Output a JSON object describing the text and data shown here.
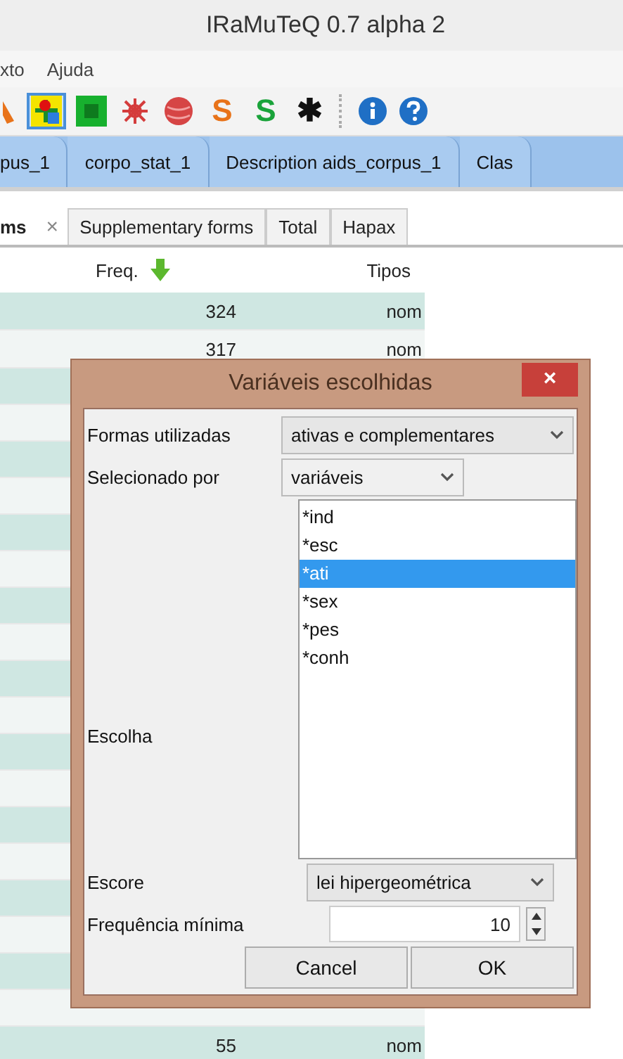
{
  "window": {
    "title": "IRaMuTeQ 0.7 alpha 2"
  },
  "menu": [
    "xto",
    "Ajuda"
  ],
  "toolbar": [
    {
      "kind": "partial",
      "selected": false
    },
    {
      "kind": "cross",
      "selected": true
    },
    {
      "kind": "square",
      "selected": false
    },
    {
      "kind": "flower",
      "selected": false
    },
    {
      "kind": "ball",
      "selected": false
    },
    {
      "kind": "glyph",
      "text": "S",
      "color": "#e8731a",
      "selected": false
    },
    {
      "kind": "glyph",
      "text": "S",
      "color": "#1aa33a",
      "selected": false
    },
    {
      "kind": "glyph",
      "text": "✱",
      "color": "#111111",
      "selected": false
    },
    {
      "kind": "separator"
    },
    {
      "kind": "info",
      "selected": false
    },
    {
      "kind": "help",
      "selected": false
    }
  ],
  "notebook_tabs": [
    "pus_1",
    "corpo_stat_1",
    "Description aids_corpus_1",
    "Clas"
  ],
  "sub_tabs": [
    {
      "label": "ms",
      "selected": true,
      "close": "×"
    },
    {
      "label": "Supplementary forms",
      "selected": false
    },
    {
      "label": "Total",
      "selected": false
    },
    {
      "label": "Hapax",
      "selected": false
    }
  ],
  "table": {
    "columns": [
      "Freq.",
      "Tipos"
    ],
    "rows_top": [
      {
        "freq": "324",
        "type": "nom"
      },
      {
        "freq": "317",
        "type": "nom"
      }
    ],
    "rows_bottom": [
      {
        "freq": "55",
        "type": "nom"
      }
    ]
  },
  "dialog": {
    "title": "Variáveis escolhidas",
    "close": "×",
    "formas": {
      "label": "Formas utilizadas",
      "value": "ativas e complementares"
    },
    "selecionado": {
      "label": "Selecionado por",
      "value": "variáveis"
    },
    "escolha": {
      "label": "Escolha",
      "items": [
        {
          "text": "*ind",
          "selected": false
        },
        {
          "text": "*esc",
          "selected": false
        },
        {
          "text": "*ati",
          "selected": true
        },
        {
          "text": "*sex",
          "selected": false
        },
        {
          "text": "*pes",
          "selected": false
        },
        {
          "text": "*conh",
          "selected": false
        }
      ]
    },
    "escore": {
      "label": "Escore",
      "value": "lei hipergeométrica"
    },
    "frequencia": {
      "label": "Frequência mínima",
      "value": "10"
    },
    "buttons": [
      "Cancel",
      "OK"
    ]
  }
}
